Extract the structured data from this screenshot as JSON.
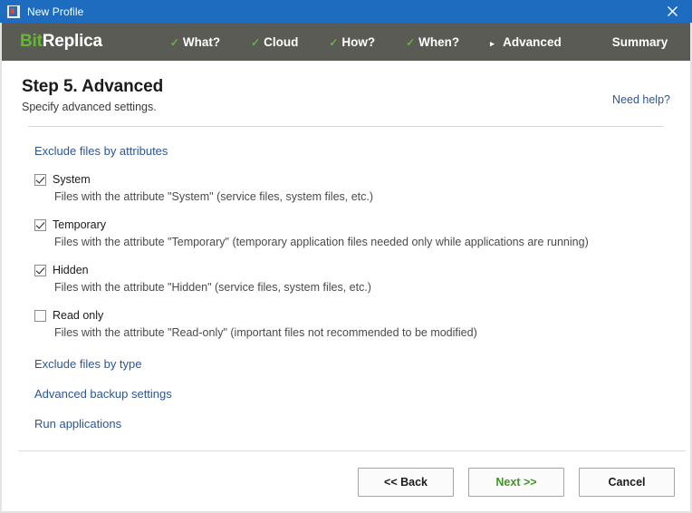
{
  "window": {
    "title": "New Profile",
    "icon": "app-icon",
    "close_label": "×"
  },
  "navbar": {
    "brand_first": "Bit",
    "brand_second": "Replica",
    "items": [
      {
        "label": "What?",
        "marker": "✓",
        "state": "completed"
      },
      {
        "label": "Cloud",
        "marker": "✓",
        "state": "completed"
      },
      {
        "label": "How?",
        "marker": "✓",
        "state": "completed"
      },
      {
        "label": "When?",
        "marker": "✓",
        "state": "completed"
      },
      {
        "label": "Advanced",
        "marker": "▸",
        "state": "current"
      },
      {
        "label": "Summary",
        "marker": "",
        "state": "upcoming"
      }
    ]
  },
  "header": {
    "title": "Step 5. Advanced",
    "subtitle": "Specify advanced settings.",
    "need_help": "Need help?"
  },
  "content": {
    "section_title": "Exclude files by attributes",
    "attributes": [
      {
        "label": "System",
        "checked": true,
        "description": "Files with the attribute \"System\" (service files, system files, etc.)"
      },
      {
        "label": "Temporary",
        "checked": true,
        "description": "Files with the attribute \"Temporary\" (temporary application files needed only while applications are running)"
      },
      {
        "label": "Hidden",
        "checked": true,
        "description": "Files with the attribute \"Hidden\" (service files, system files, etc.)"
      },
      {
        "label": "Read only",
        "checked": false,
        "description": "Files with the attribute \"Read-only\" (important files not recommended to be modified)"
      }
    ],
    "links": [
      "Exclude files by type",
      "Advanced backup settings",
      "Run applications"
    ]
  },
  "footer": {
    "back": "<< Back",
    "next": "Next >>",
    "cancel": "Cancel"
  },
  "colors": {
    "titlebar": "#1d6cc0",
    "navbar": "#5b5b55",
    "brand_accent": "#63b832",
    "link": "#2a5699",
    "next_text": "#3f9625"
  }
}
